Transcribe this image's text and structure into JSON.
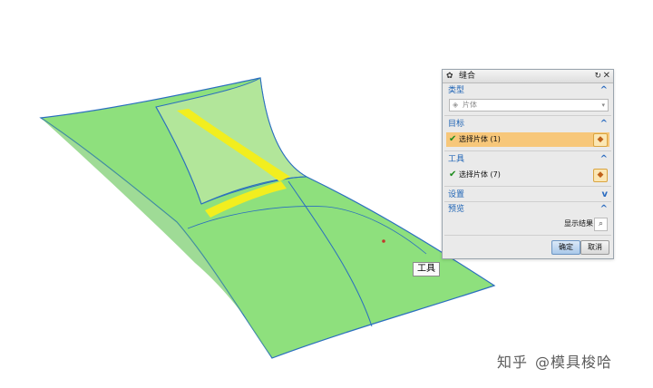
{
  "viewport": {
    "tooltip": "工具"
  },
  "dialog": {
    "title": "缝合",
    "type_section": {
      "label": "类型",
      "selected": "片体"
    },
    "target_section": {
      "label": "目标",
      "row_label": "选择片体 (1)"
    },
    "tool_section": {
      "label": "工具",
      "row_label": "选择片体 (7)"
    },
    "settings_section": {
      "label": "设置"
    },
    "preview_section": {
      "label": "预览",
      "show_result": "显示结果"
    },
    "ok_label": "确定",
    "cancel_label": "取消"
  },
  "watermark": {
    "site": "知乎",
    "author": "@模具梭哈"
  },
  "colors": {
    "surface": "#8ee07d",
    "surface_shade": "#a8e391",
    "edge": "#2b6fbf",
    "highlight_strip": "#f2ee1f",
    "active_row": "#f7c77a"
  }
}
